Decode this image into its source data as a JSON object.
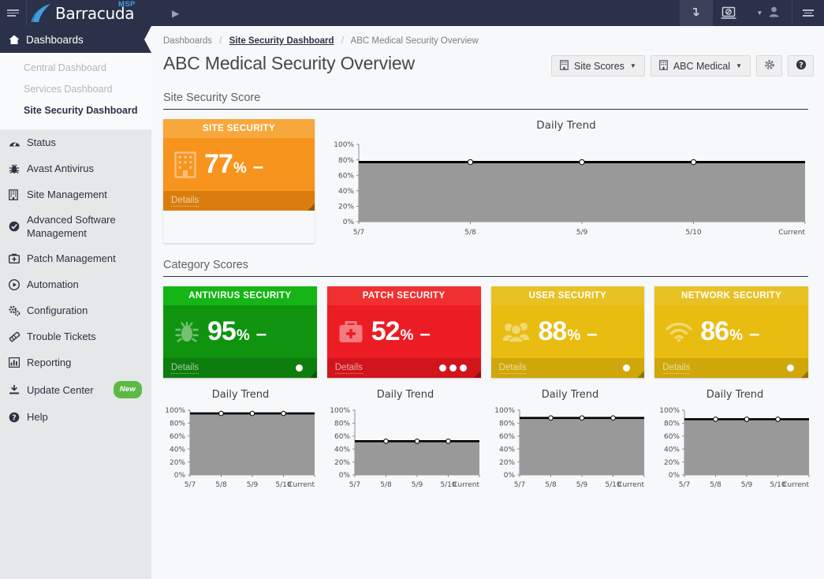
{
  "topbar": {
    "brand": "Barracuda",
    "brand_sup": "MSP",
    "menu_icon": "hamburger-icon",
    "expander_icon": "chevron-right-icon",
    "download_icon": "download-arrow-icon",
    "remote_icon": "remote-screen-icon",
    "caret_icon": "chevron-down-icon",
    "user_icon": "user-avatar-icon",
    "app_menu_icon": "hamburger-icon"
  },
  "sidebar": {
    "header": {
      "label": "Dashboards",
      "icon": "home-icon"
    },
    "sub_items": [
      {
        "label": "Central Dashboard",
        "active": false
      },
      {
        "label": "Services Dashboard",
        "active": false
      },
      {
        "label": "Site Security Dashboard",
        "active": true
      }
    ],
    "items": [
      {
        "label": "Status",
        "icon": "gauge-icon",
        "badge": ""
      },
      {
        "label": "Avast Antivirus",
        "icon": "bug-icon",
        "badge": ""
      },
      {
        "label": "Site Management",
        "icon": "building-icon",
        "badge": ""
      },
      {
        "label": "Advanced Software Management",
        "icon": "check-circle-icon",
        "badge": ""
      },
      {
        "label": "Patch Management",
        "icon": "firstaid-icon",
        "badge": ""
      },
      {
        "label": "Automation",
        "icon": "play-circle-icon",
        "badge": ""
      },
      {
        "label": "Configuration",
        "icon": "gears-icon",
        "badge": ""
      },
      {
        "label": "Trouble Tickets",
        "icon": "ticket-icon",
        "badge": ""
      },
      {
        "label": "Reporting",
        "icon": "bar-chart-icon",
        "badge": ""
      },
      {
        "label": "Update Center",
        "icon": "download-tray-icon",
        "badge": "New"
      },
      {
        "label": "Help",
        "icon": "question-circle-icon",
        "badge": ""
      }
    ]
  },
  "breadcrumb": {
    "root": "Dashboards",
    "link": "Site Security Dashboard",
    "current": "ABC Medical Security Overview",
    "separator": "/"
  },
  "page": {
    "title": "ABC Medical Security Overview",
    "section_site": "Site Security Score",
    "section_category": "Category Scores"
  },
  "toolbar": {
    "site_scores_label": "Site Scores",
    "site_scores_icon": "building-icon",
    "customer_label": "ABC Medical",
    "customer_icon": "building-icon",
    "settings_icon": "gear-icon",
    "help_icon": "question-circle-icon",
    "caret": "▼"
  },
  "site_card": {
    "header": "SITE SECURITY",
    "value": "77",
    "percent": "%",
    "trend": "–",
    "details": "Details",
    "icon": "building-icon",
    "color": "#f7941e",
    "dots": 0
  },
  "category_cards": [
    {
      "header": "ANTIVIRUS SECURITY",
      "value": "95",
      "percent": "%",
      "trend": "–",
      "details": "Details",
      "icon": "bug-icon",
      "color": "#109410",
      "dots": 1
    },
    {
      "header": "PATCH SECURITY",
      "value": "52",
      "percent": "%",
      "trend": "–",
      "details": "Details",
      "icon": "firstaid-icon",
      "color": "#ec1c24",
      "dots": 3
    },
    {
      "header": "USER SECURITY",
      "value": "88",
      "percent": "%",
      "trend": "–",
      "details": "Details",
      "icon": "users-icon",
      "color": "#e8bc10",
      "dots": 1
    },
    {
      "header": "NETWORK SECURITY",
      "value": "86",
      "percent": "%",
      "trend": "–",
      "details": "Details",
      "icon": "wifi-icon",
      "color": "#e8bc10",
      "dots": 1
    }
  ],
  "chart_data": [
    {
      "id": "site-daily-trend",
      "type": "area",
      "title": "Daily Trend",
      "categories": [
        "5/7",
        "5/8",
        "5/9",
        "5/10",
        "Current"
      ],
      "values": [
        77,
        77,
        77,
        77,
        77
      ],
      "ytick_labels": [
        "0%",
        "20%",
        "40%",
        "60%",
        "80%",
        "100%"
      ],
      "yticks": [
        0,
        20,
        40,
        60,
        80,
        100
      ],
      "ylim": [
        0,
        100
      ],
      "xlabel": "",
      "ylabel": "",
      "grid": false,
      "legend": false,
      "line_color": "#000000",
      "fill_color": "#999999",
      "marker": "circle"
    },
    {
      "id": "antivirus-daily-trend",
      "type": "area",
      "title": "Daily Trend",
      "categories": [
        "5/7",
        "5/8",
        "5/9",
        "5/10",
        "Current"
      ],
      "values": [
        95,
        95,
        95,
        95,
        95
      ],
      "ytick_labels": [
        "0%",
        "20%",
        "40%",
        "60%",
        "80%",
        "100%"
      ],
      "yticks": [
        0,
        20,
        40,
        60,
        80,
        100
      ],
      "ylim": [
        0,
        100
      ],
      "xlabel": "",
      "ylabel": "",
      "grid": false,
      "legend": false,
      "line_color": "#000000",
      "fill_color": "#999999",
      "marker": "circle"
    },
    {
      "id": "patch-daily-trend",
      "type": "area",
      "title": "Daily Trend",
      "categories": [
        "5/7",
        "5/8",
        "5/9",
        "5/10",
        "Current"
      ],
      "values": [
        52,
        52,
        52,
        52,
        52
      ],
      "ytick_labels": [
        "0%",
        "20%",
        "40%",
        "60%",
        "80%",
        "100%"
      ],
      "yticks": [
        0,
        20,
        40,
        60,
        80,
        100
      ],
      "ylim": [
        0,
        100
      ],
      "xlabel": "",
      "ylabel": "",
      "grid": false,
      "legend": false,
      "line_color": "#000000",
      "fill_color": "#999999",
      "marker": "circle"
    },
    {
      "id": "user-daily-trend",
      "type": "area",
      "title": "Daily Trend",
      "categories": [
        "5/7",
        "5/8",
        "5/9",
        "5/10",
        "Current"
      ],
      "values": [
        88,
        88,
        88,
        88,
        88
      ],
      "ytick_labels": [
        "0%",
        "20%",
        "40%",
        "60%",
        "80%",
        "100%"
      ],
      "yticks": [
        0,
        20,
        40,
        60,
        80,
        100
      ],
      "ylim": [
        0,
        100
      ],
      "xlabel": "",
      "ylabel": "",
      "grid": false,
      "legend": false,
      "line_color": "#000000",
      "fill_color": "#999999",
      "marker": "circle"
    },
    {
      "id": "network-daily-trend",
      "type": "area",
      "title": "Daily Trend",
      "categories": [
        "5/7",
        "5/8",
        "5/9",
        "5/10",
        "Current"
      ],
      "values": [
        86,
        86,
        86,
        86,
        86
      ],
      "ytick_labels": [
        "0%",
        "20%",
        "40%",
        "60%",
        "80%",
        "100%"
      ],
      "yticks": [
        0,
        20,
        40,
        60,
        80,
        100
      ],
      "ylim": [
        0,
        100
      ],
      "xlabel": "",
      "ylabel": "",
      "grid": false,
      "legend": false,
      "line_color": "#000000",
      "fill_color": "#999999",
      "marker": "circle"
    }
  ]
}
